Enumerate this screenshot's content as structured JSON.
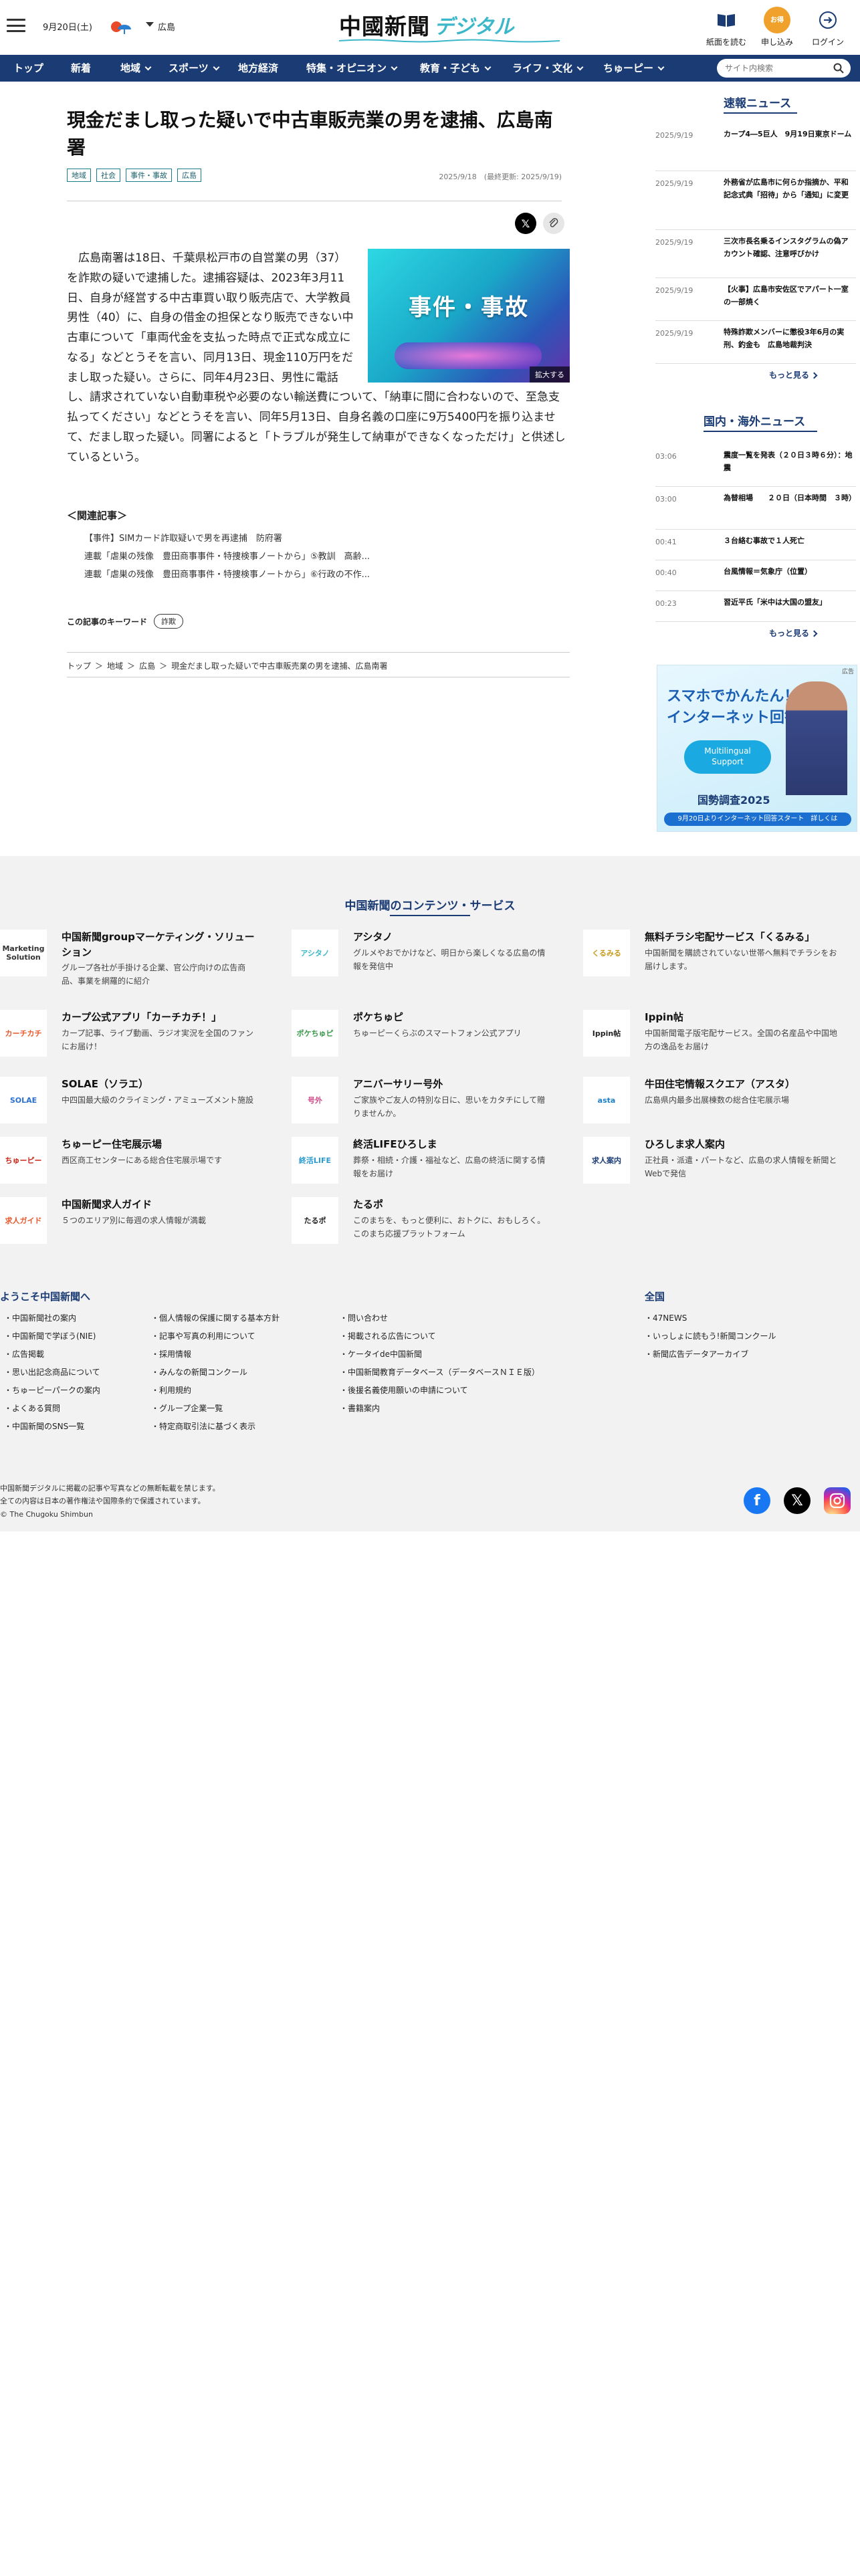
{
  "header": {
    "date": "9月20日(土)",
    "region": "広島",
    "logo_kanji": "中國新聞",
    "logo_digital": "デジタル",
    "btn_paper": "紙面を読む",
    "btn_apply": "申し込み",
    "btn_apply_badge": "お得な\nキャンペーン",
    "btn_login": "ログイン"
  },
  "nav": {
    "items": [
      "トップ",
      "新着",
      "地域",
      "スポーツ",
      "地方経済",
      "特集・オピニオン",
      "教育・子ども",
      "ライフ・文化",
      "ちゅーピー"
    ],
    "search_placeholder": "サイト内検索"
  },
  "article": {
    "title": "現金だまし取った疑いで中古車販売業の男を逮捕、広島南署",
    "tags": [
      "地域",
      "社会",
      "事件・事故",
      "広島"
    ],
    "date": "2025/9/18　(最終更新: 2025/9/19)",
    "photo_text": "事件・事故",
    "zoom_label": "拡大する",
    "body": "広島南署は18日、千葉県松戸市の自営業の男（37）を詐欺の疑いで逮捕した。逮捕容疑は、2023年3月11日、自身が経営する中古車買い取り販売店で、大学教員男性（40）に、自身の借金の担保となり販売できない中古車について「車両代金を支払った時点で正式な成立になる」などとうそを言い、同月13日、現金110万円をだまし取った疑い。さらに、同年4月23日、男性に電話し、請求されていない自動車税や必要のない輸送費について、「納車に間に合わないので、至急支払ってください」などとうそを言い、同年5月13日、自身名義の口座に9万5400円を振り込ませて、だまし取った疑い。同署によると「トラブルが発生して納車ができなくなっただけ」と供述しているという。",
    "related_heading": "＜関連記事＞",
    "related": [
      "【事件】SIMカード詐取疑いで男を再逮捕　防府署",
      "連載「虐巣の残像　豊田商事事件・特捜検事ノートから」⑤教訓　高齢...",
      "連載「虐巣の残像　豊田商事事件・特捜検事ノートから」⑥行政の不作..."
    ],
    "keyword_label": "この記事のキーワード",
    "keyword": "詐欺"
  },
  "breadcrumb": [
    "トップ",
    "地域",
    "広島",
    "現金だまし取った疑いで中古車販売業の男を逮捕、広島南署"
  ],
  "sidebar": {
    "flash_heading": "速報ニュース",
    "flash": [
      {
        "date": "2025/9/19",
        "title": "カープ4―5巨人　9月19日東京ドーム"
      },
      {
        "date": "2025/9/19",
        "title": "外務省が広島市に何らか指摘か、平和記念式典「招待」から「通知」に変更"
      },
      {
        "date": "2025/9/19",
        "title": "三次市長名乗るインスタグラムの偽アカウント確認、注意呼びかけ"
      },
      {
        "date": "2025/9/19",
        "title": "【火事】広島市安佐区でアパート一室の一部焼く"
      },
      {
        "date": "2025/9/19",
        "title": "特殊詐欺メンバーに懲役3年6月の実刑、釣金も　広島地裁判決"
      }
    ],
    "more": "もっと見る",
    "world_heading": "国内・海外ニュース",
    "world": [
      {
        "date": "03:06",
        "title": "震度一覧を発表（２０日３時６分）：地震"
      },
      {
        "date": "03:00",
        "title": "為替相場　　２０日（日本時間　３時）"
      },
      {
        "date": "00:41",
        "title": "３台絡む事故で１人死亡"
      },
      {
        "date": "00:40",
        "title": "台風情報＝気象庁（位置）"
      },
      {
        "date": "00:23",
        "title": "習近平氏「米中は大国の盟友」"
      }
    ]
  },
  "ad": {
    "badge": "広告",
    "line1": "スマホでかんたん！",
    "line2": "インターネット回答",
    "bubble": "Multilingual\nSupport",
    "brand": "国勢調査2025",
    "bar": "9月20日よりインターネット回答スタート　詳しくは"
  },
  "footer": {
    "services_heading": "中国新聞のコンテンツ・サービス",
    "services": [
      {
        "name": "中国新聞groupマーケティング・ソリューション",
        "desc": "グループ各社が手掛ける企業、官公庁向けの広告商品、事業を網羅的に紹介",
        "logo": "Marketing Solution",
        "color": "#333333"
      },
      {
        "name": "アシタノ",
        "desc": "グルメやおでかけなど、明日から楽しくなる広島の情報を発信中",
        "logo": "アシタノ",
        "color": "#3cb7c9"
      },
      {
        "name": "無料チラシ宅配サービス「くるみる」",
        "desc": "中国新聞を購読されていない世帯へ無料でチラシをお届けします。",
        "logo": "くるみる",
        "color": "#c89a1a"
      },
      {
        "name": "カープ公式アプリ「カーチカチ！」",
        "desc": "カープ記事、ライブ動画、ラジオ実況を全国のファンにお届け！",
        "logo": "カーチカチ",
        "color": "#e8572a"
      },
      {
        "name": "ポケちゅピ",
        "desc": "ちゅーピーくらぶのスマートフォン公式アプリ",
        "logo": "ポケちゅピ",
        "color": "#3a9a4a"
      },
      {
        "name": "Ippin帖",
        "desc": "中国新聞電子版宅配サービス。全国の名産品や中国地方の逸品をお届け",
        "logo": "Ippin帖",
        "color": "#222222"
      },
      {
        "name": "SOLAE（ソラエ）",
        "desc": "中四国最大級のクライミング・アミューズメント施設",
        "logo": "SOLAE",
        "color": "#2a6fd0"
      },
      {
        "name": "アニバーサリー号外",
        "desc": "ご家族やご友人の特別な日に、思いをカタチにして贈りませんか。",
        "logo": "号外",
        "color": "#d04a8a"
      },
      {
        "name": "牛田住宅情報スクエア（アスタ）",
        "desc": "広島県内最多出展棟数の総合住宅展示場",
        "logo": "asta",
        "color": "#1a7fc8"
      },
      {
        "name": "ちゅーピー住宅展示場",
        "desc": "西区商工センターにある総合住宅展示場です",
        "logo": "ちゅーピー",
        "color": "#c8281a"
      },
      {
        "name": "終活LIFEひろしま",
        "desc": "葬祭・相続・介護・福祉など、広島の終活に関する情報をお届け",
        "logo": "終活LIFE",
        "color": "#2a9ad0"
      },
      {
        "name": "ひろしま求人案内",
        "desc": "正社員・派遣・パートなど、広島の求人情報を新聞とWebで発信",
        "logo": "求人案内",
        "color": "#1a3b73"
      },
      {
        "name": "中国新聞求人ガイド",
        "desc": "５つのエリア別に毎週の求人情報が満載",
        "logo": "求人ガイド",
        "color": "#e8572a"
      },
      {
        "name": "たるポ",
        "desc": "このまちを、もっと便利に、おトクに、おもしろく。このまち応援プラットフォーム",
        "logo": "たるポ",
        "color": "#222222"
      }
    ],
    "welcome_heading": "ようこそ中国新聞へ",
    "col1": [
      "中国新聞社の案内",
      "中国新聞で学ぼう(NIE)",
      "広告掲載",
      "思い出記念商品について",
      "ちゅーピーパークの案内",
      "よくある質問",
      "中国新聞のSNS一覧"
    ],
    "col2": [
      "個人情報の保護に関する基本方針",
      "記事や写真の利用について",
      "採用情報",
      "みんなの新聞コンクール",
      "利用規約",
      "グループ企業一覧",
      "特定商取引法に基づく表示"
    ],
    "col3": [
      "問い合わせ",
      "掲載される広告について",
      "ケータイde中国新聞",
      "中国新聞教育データベース（データベースＮＩＥ版）",
      "後援名義使用願いの申請について",
      "書籍案内"
    ],
    "national_heading": "全国",
    "col4": [
      "47NEWS",
      "いっしょに読もう!新聞コンクール",
      "新聞広告データアーカイブ"
    ],
    "copy1": "中国新聞デジタルに掲載の記事や写真などの無断転載を禁じます。",
    "copy2": "全ての内容は日本の著作権法や国際条約で保護されています。",
    "copy3": "© The Chugoku Shimbun"
  }
}
